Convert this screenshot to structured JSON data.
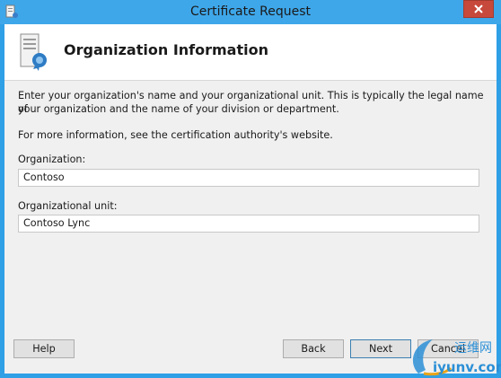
{
  "window": {
    "title": "Certificate Request"
  },
  "header": {
    "title": "Organization Information"
  },
  "body": {
    "intro_line1": "Enter your organization's name and your organizational unit. This is typically the legal name of",
    "intro_line2": "your organization and the name of your division or department.",
    "more_info": "For more information, see the certification authority's website."
  },
  "fields": {
    "organization_label": "Organization:",
    "organization_value": "Contoso",
    "unit_label": "Organizational unit:",
    "unit_value": "Contoso  Lync"
  },
  "buttons": {
    "help": "Help",
    "back": "Back",
    "next": "Next",
    "cancel": "Cancel"
  },
  "watermark": {
    "brand_cn": "运维网",
    "domain": "iyunv.com"
  },
  "colors": {
    "title_bar": "#3ea7ea",
    "close_button": "#c7493c",
    "dialog_background": "#f0f0f0"
  }
}
